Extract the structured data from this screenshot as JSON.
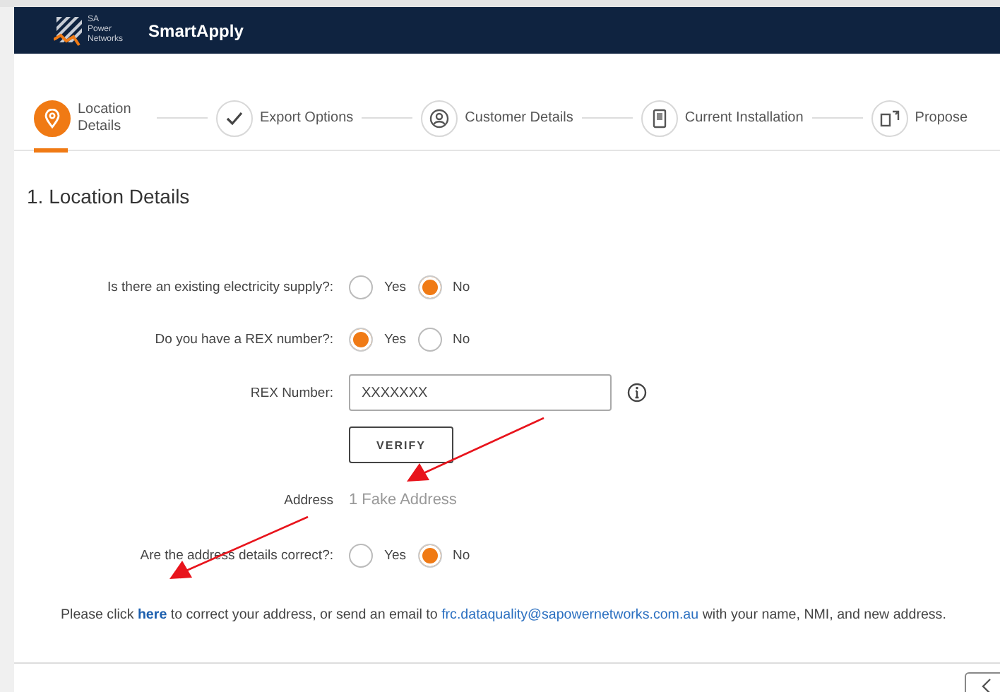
{
  "header": {
    "logo_lines": [
      "SA",
      "Power",
      "Networks"
    ],
    "title": "SmartApply"
  },
  "steps": [
    {
      "label": "Location Details",
      "kind": "pin",
      "selected": true
    },
    {
      "label": "Export Options",
      "kind": "check",
      "selected": false
    },
    {
      "label": "Customer Details",
      "kind": "person",
      "selected": false
    },
    {
      "label": "Current Installation",
      "kind": "device",
      "selected": false
    },
    {
      "label": "Propose",
      "kind": "swap",
      "selected": false
    }
  ],
  "section_title": "1. Location Details",
  "form": [
    {
      "kind": "radio",
      "label": "Is there an existing electricity supply?:",
      "options": [
        {
          "label": "Yes",
          "selected": false
        },
        {
          "label": "No",
          "selected": true
        }
      ]
    },
    {
      "kind": "radio",
      "label": "Do you have a REX number?:",
      "options": [
        {
          "label": "Yes",
          "selected": true
        },
        {
          "label": "No",
          "selected": false
        }
      ]
    },
    {
      "kind": "input",
      "label": "REX Number:",
      "value": "XXXXXXX"
    },
    {
      "kind": "button",
      "label": "VERIFY"
    },
    {
      "kind": "text",
      "label": "Address",
      "value": "1 Fake Address"
    },
    {
      "kind": "radio",
      "label": "Are the address details correct?:",
      "options": [
        {
          "label": "Yes",
          "selected": false
        },
        {
          "label": "No",
          "selected": true
        }
      ]
    }
  ],
  "notice": {
    "before": "Please click",
    "link": "here",
    "middle": "to correct your address, or send an email to",
    "email": "frc.dataquality@sapowernetworks.com.au",
    "after": "with your name, NMI, and new address."
  }
}
